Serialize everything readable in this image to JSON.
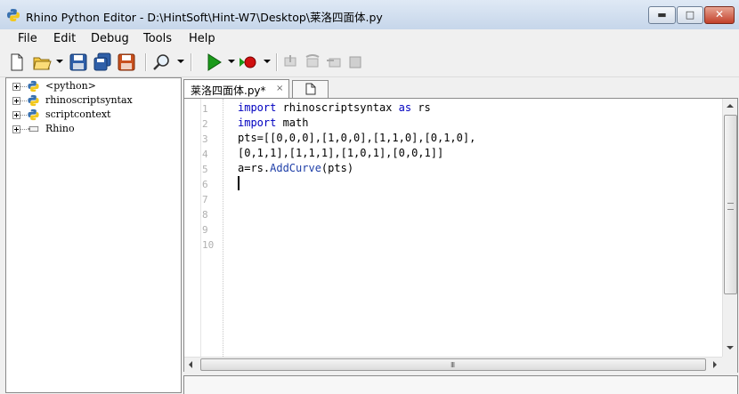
{
  "window": {
    "title": "Rhino Python Editor - D:\\HintSoft\\Hint-W7\\Desktop\\莱洛四面体.py",
    "controls": {
      "minimize": "▬",
      "maximize": "□",
      "close": "✕"
    }
  },
  "menu": {
    "items": [
      "File",
      "Edit",
      "Debug",
      "Tools",
      "Help"
    ]
  },
  "toolbar": {
    "icons": [
      "new-file-icon",
      "open-folder-icon",
      "save-icon",
      "save-all-icon",
      "save-as-icon",
      "find-icon",
      "run-icon",
      "debug-record-icon",
      "step-into-icon",
      "step-over-icon",
      "step-out-icon",
      "stop-icon"
    ]
  },
  "tree": {
    "items": [
      {
        "label": "<python>",
        "icon": "python-module-icon"
      },
      {
        "label": "rhinoscriptsyntax",
        "icon": "python-module-icon"
      },
      {
        "label": "scriptcontext",
        "icon": "python-module-icon"
      },
      {
        "label": "Rhino",
        "icon": "namespace-icon"
      }
    ]
  },
  "tabs": {
    "active_label": "莱洛四面体.py*",
    "close_glyph": "×"
  },
  "editor": {
    "line_numbers": [
      "1",
      "2",
      "3",
      "4",
      "5",
      "6",
      "7",
      "8",
      "9",
      "10"
    ],
    "lines": [
      {
        "kw1": "import",
        "text1": " rhinoscriptsyntax ",
        "kw2": "as",
        "text2": " rs"
      },
      {
        "kw1": "import",
        "text1": " math",
        "kw2": "",
        "text2": ""
      },
      {
        "text": "pts=[[0,0,0],[1,0,0],[1,1,0],[0,1,0],"
      },
      {
        "text": "[0,1,1],[1,1,1],[1,0,1],[0,0,1]]"
      },
      {
        "pre": "a=rs.",
        "fn": "AddCurve",
        "post": "(pts)"
      }
    ],
    "hscroll_grip": "III"
  },
  "colors": {
    "keyword": "#0000c0",
    "function": "#1f3fa8",
    "line_number": "#b0b0b0",
    "run_green": "#1a9a1a",
    "record_red": "#d01010"
  }
}
